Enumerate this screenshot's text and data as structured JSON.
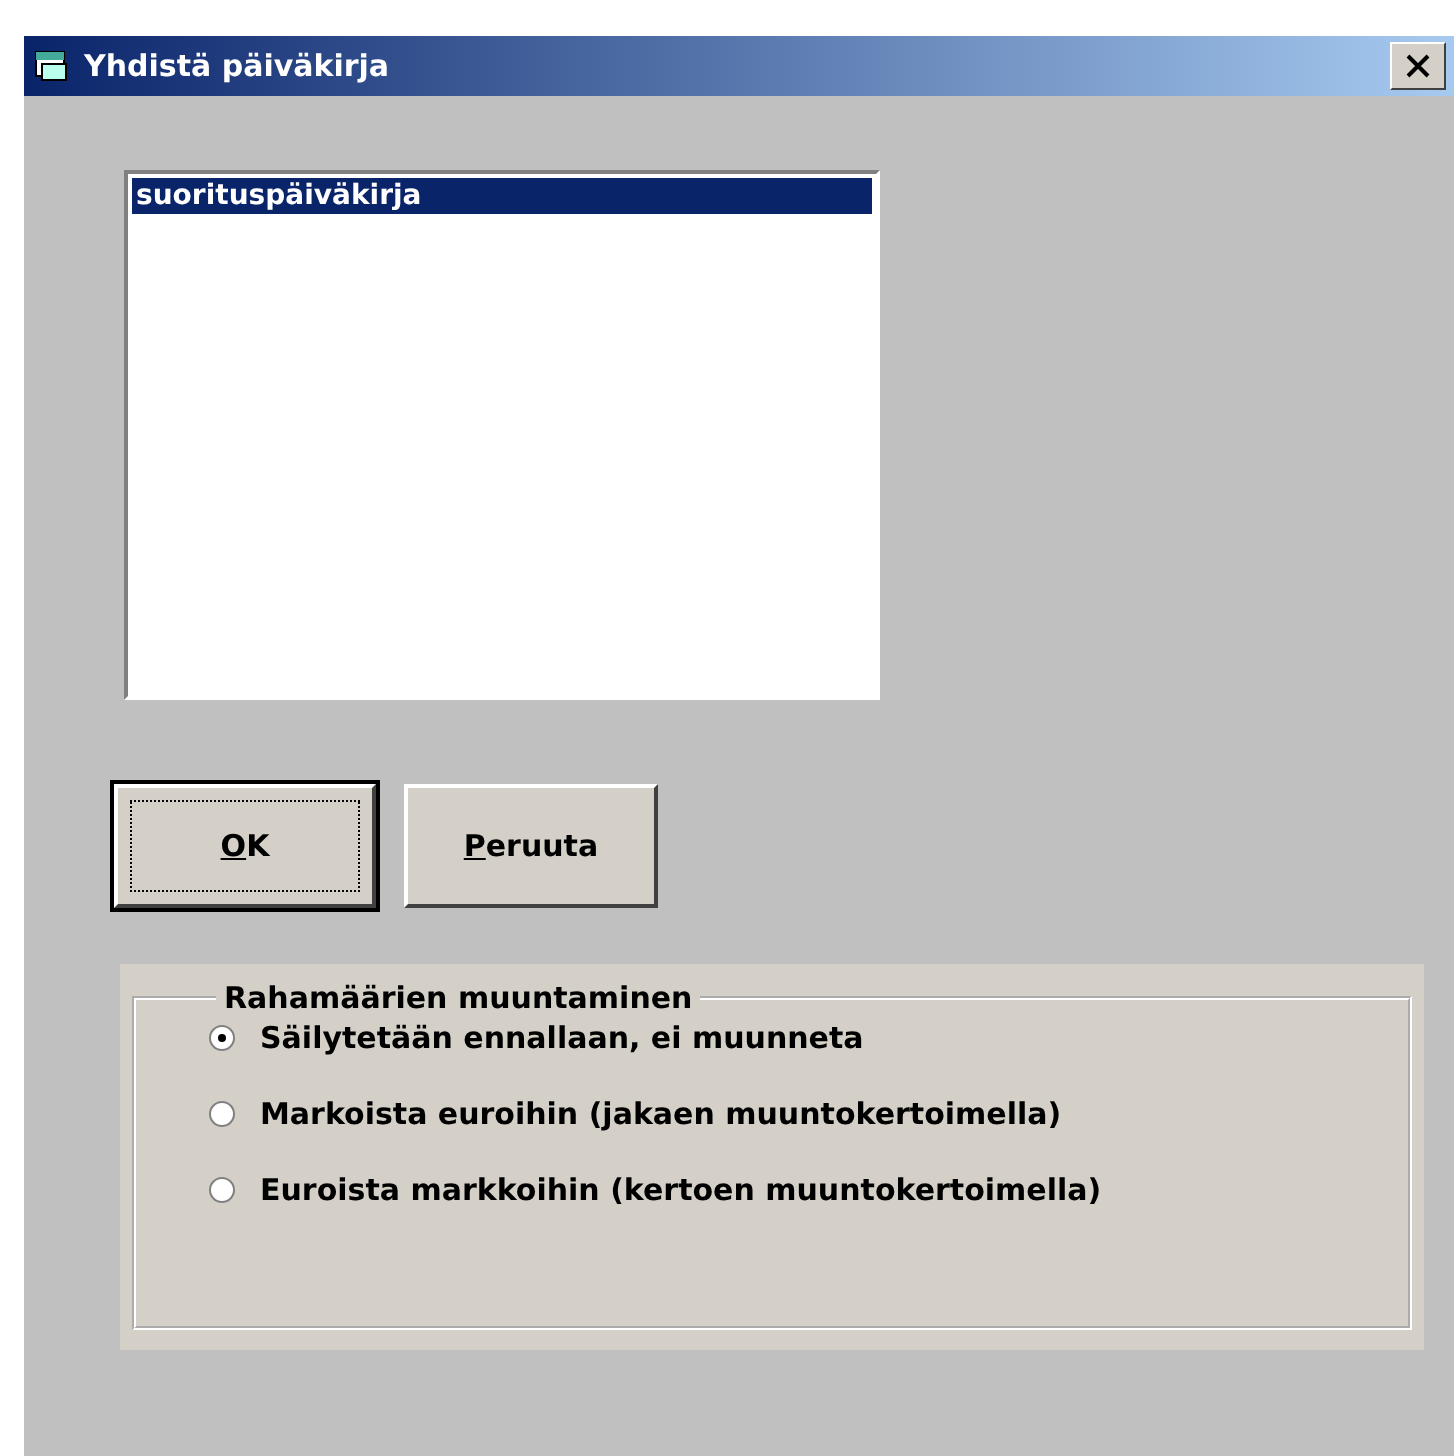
{
  "window": {
    "title": "Yhdistä päiväkirja"
  },
  "list": {
    "items": [
      {
        "label": "suorituspäiväkirja",
        "selected": true
      }
    ]
  },
  "buttons": [
    {
      "label": "OK",
      "default": true
    },
    {
      "label": "Peruuta",
      "default": false
    }
  ],
  "group": {
    "title": "Rahamäärien muuntaminen",
    "options": [
      {
        "label": "Säilytetään ennallaan, ei muunneta",
        "selected": true
      },
      {
        "label": "Markoista euroihin (jakaen muuntokertoimella)",
        "selected": false
      },
      {
        "label": "Euroista markkoihin (kertoen muuntokertoimella)",
        "selected": false
      }
    ]
  }
}
